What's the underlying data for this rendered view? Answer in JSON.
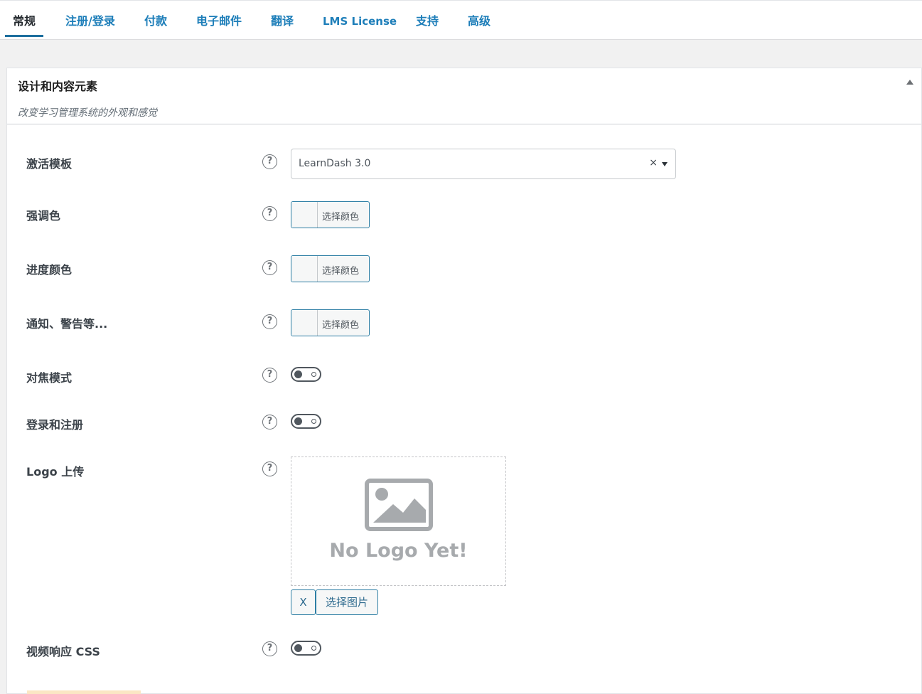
{
  "tabs": [
    {
      "label": "常规"
    },
    {
      "label": "注册/登录"
    },
    {
      "label": "付款"
    },
    {
      "label": "电子邮件"
    },
    {
      "label": "翻译"
    },
    {
      "label": "LMS License"
    },
    {
      "label": "支持"
    },
    {
      "label": "高级"
    }
  ],
  "active_tab": "常规",
  "panel": {
    "title": "设计和内容元素",
    "subtitle": "改变学习管理系统的外观和感觉",
    "collapse_icon": "triangle-up-icon"
  },
  "help_icon": "?",
  "settings": {
    "template": {
      "label": "激活模板",
      "value": "LearnDash 3.0",
      "clear": "×"
    },
    "accent_color": {
      "label": "强调色",
      "button": "选择颜色"
    },
    "progress_color": {
      "label": "进度颜色",
      "button": "选择颜色"
    },
    "notice_color": {
      "label": "通知、警告等...",
      "button": "选择颜色"
    },
    "focus_mode": {
      "label": "对焦模式",
      "enabled": false
    },
    "login_register": {
      "label": "登录和注册",
      "enabled": false
    },
    "logo_upload": {
      "label": "Logo 上传",
      "placeholder": "No Logo Yet!",
      "remove": "X",
      "select": "选择图片"
    },
    "responsive_video": {
      "label": "视频响应 CSS",
      "enabled": false
    }
  },
  "colors": {
    "accent": "#1d7eb9",
    "button_border": "#2d7ea4",
    "placeholder_icon": "#a7aaad"
  }
}
